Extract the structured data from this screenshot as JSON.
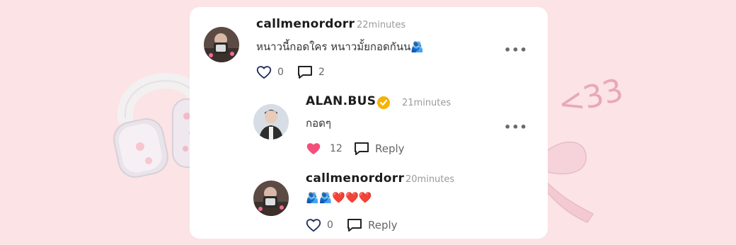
{
  "comments": [
    {
      "username": "callmenordorr",
      "time": "22minutes",
      "text": "หนาวนี้กอดใคร หนาวมั้ยกอดกันน🫂",
      "likes": "0",
      "replies": "2",
      "liked": false
    },
    {
      "username": "ALAN.BUS",
      "verified": true,
      "time": "21minutes",
      "text": "กอดๆ",
      "likes": "12",
      "reply_label": "Reply",
      "liked": true
    },
    {
      "username": "callmenordorr",
      "time": "20minutes",
      "text": "🫂🫂❤️❤️❤️",
      "likes": "0",
      "reply_label": "Reply",
      "liked": false
    }
  ],
  "doodle_text": "<33",
  "colors": {
    "background": "#fbe3e6",
    "like_active": "#f2507a",
    "icon_navy": "#1f2a5a",
    "verified_gold": "#f5b400"
  }
}
